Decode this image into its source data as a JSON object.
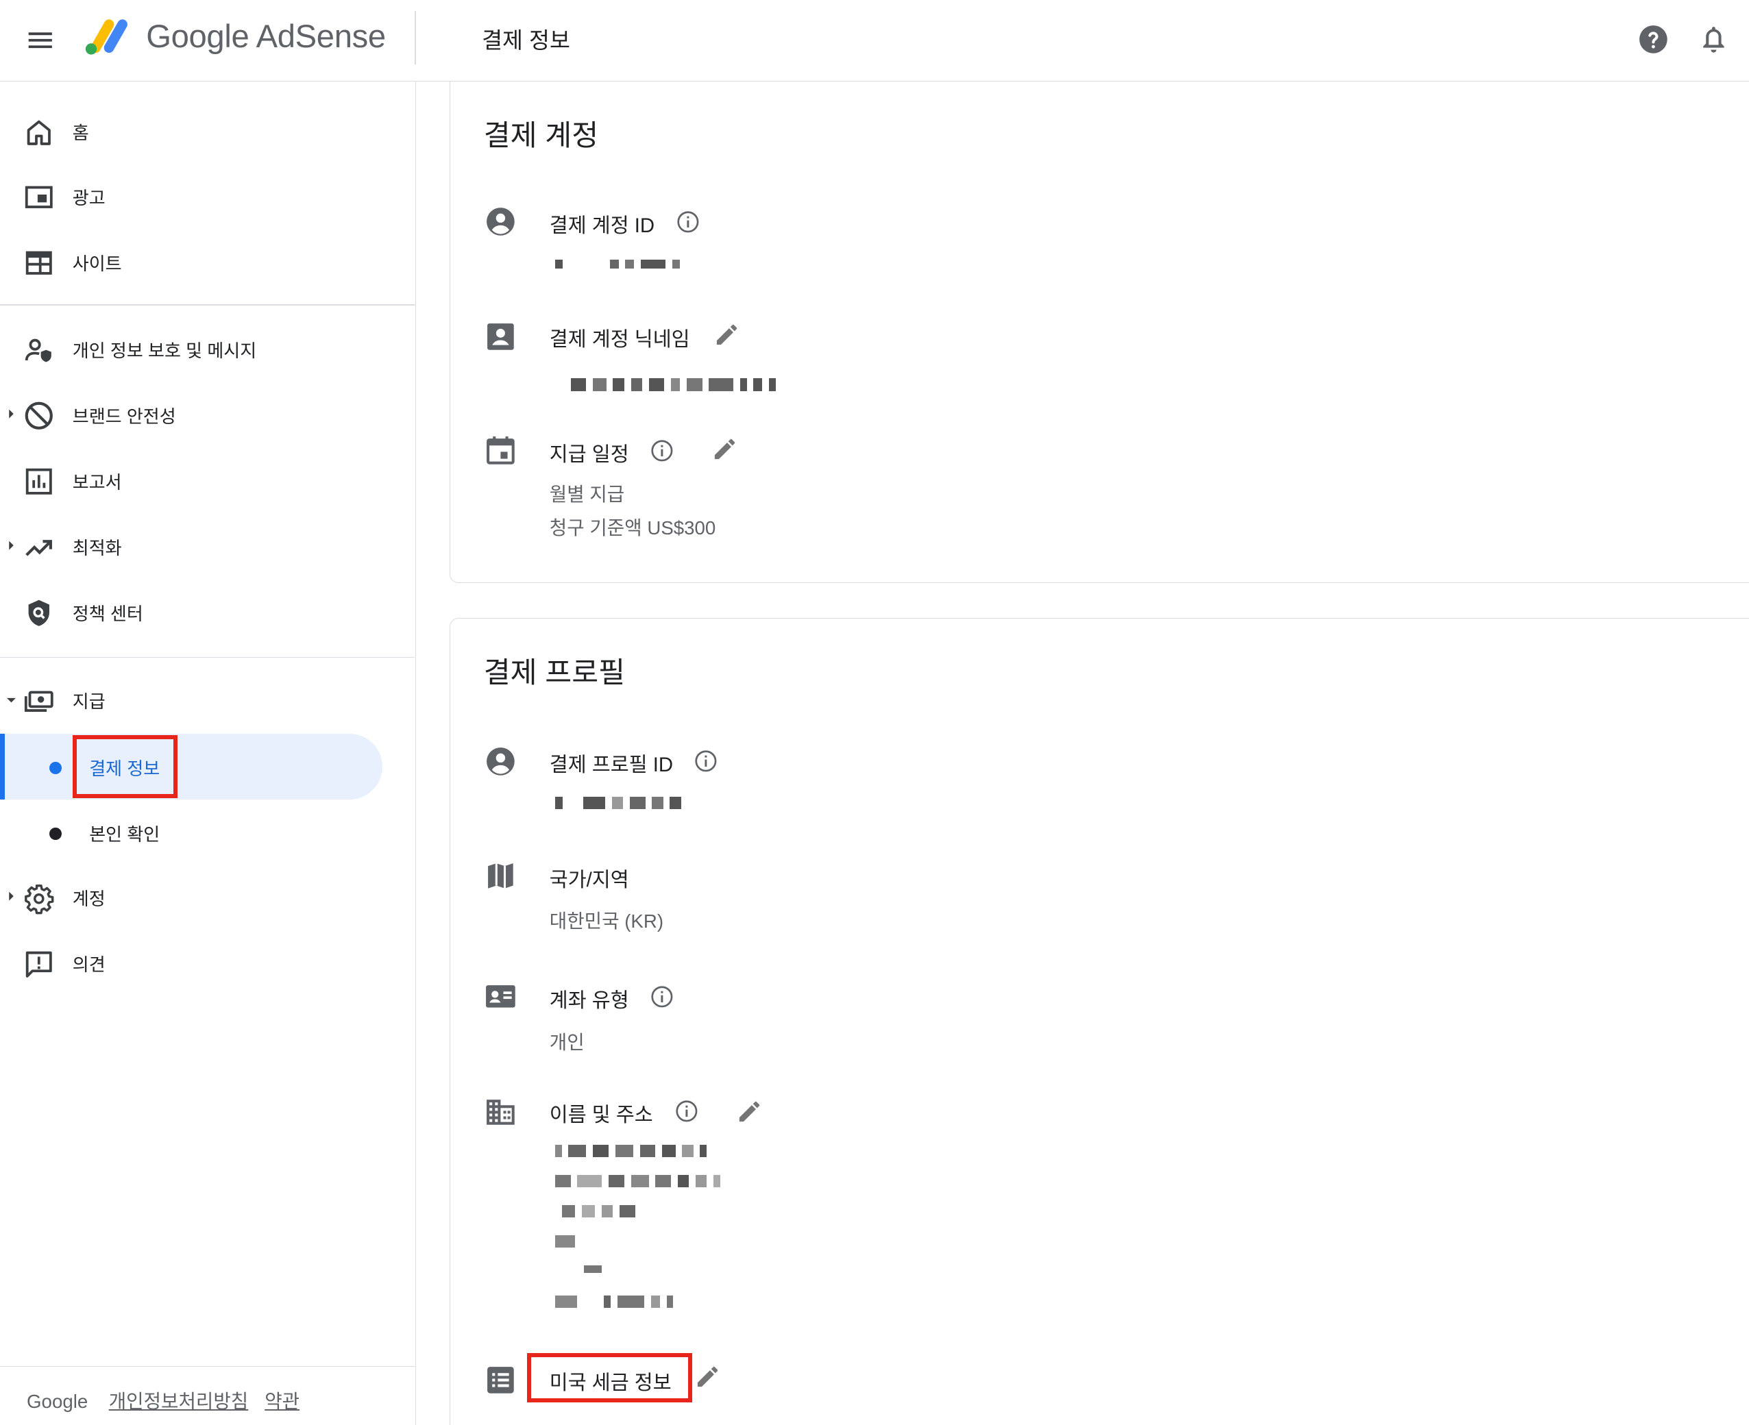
{
  "header": {
    "brand": "Google AdSense",
    "title": "결제 정보"
  },
  "sidebar": {
    "items": [
      {
        "label": "홈",
        "icon": "home-icon"
      },
      {
        "label": "광고",
        "icon": "ads-icon"
      },
      {
        "label": "사이트",
        "icon": "sites-icon"
      },
      {
        "label": "개인 정보 보호 및 메시지",
        "icon": "privacy-messaging-icon"
      },
      {
        "label": "브랜드 안전성",
        "icon": "block-icon"
      },
      {
        "label": "보고서",
        "icon": "reports-icon"
      },
      {
        "label": "최적화",
        "icon": "trending-icon"
      },
      {
        "label": "정책 센터",
        "icon": "policy-shield-icon"
      },
      {
        "label": "지급",
        "icon": "payments-icon"
      },
      {
        "label": "계정",
        "icon": "gear-icon"
      },
      {
        "label": "의견",
        "icon": "feedback-icon"
      }
    ],
    "payments_sub": [
      {
        "label": "결제 정보",
        "active": true
      },
      {
        "label": "본인 확인",
        "active": false
      }
    ],
    "footer": {
      "google": "Google",
      "privacy": "개인정보처리방침",
      "terms": "약관"
    }
  },
  "payments_account": {
    "title": "결제 계정",
    "id_label": "결제 계정 ID",
    "nickname_label": "결제 계정 닉네임",
    "schedule_label": "지급 일정",
    "schedule_value1": "월별 지급",
    "schedule_value2": "청구 기준액 US$300"
  },
  "payments_profile": {
    "title": "결제 프로필",
    "id_label": "결제 프로필 ID",
    "country_label": "국가/지역",
    "country_value": "대한민국 (KR)",
    "account_type_label": "계좌 유형",
    "account_type_value": "개인",
    "name_address_label": "이름 및 주소",
    "us_tax_label": "미국 세금 정보"
  },
  "colors": {
    "accent": "#1a73e8",
    "active_bg": "#e8f0fe",
    "highlight_box": "#e8251b",
    "icon_gray": "#5f6368"
  }
}
